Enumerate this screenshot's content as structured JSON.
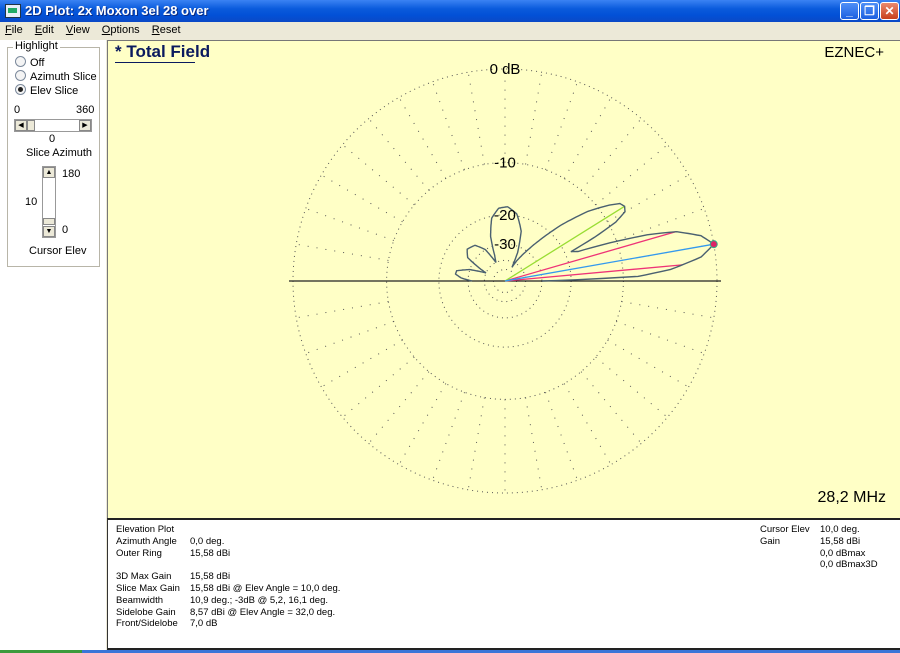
{
  "window": {
    "title": "2D Plot: 2x Moxon 3el 28 over",
    "controls": {
      "minimize": "_",
      "restore": "❐",
      "close": "✕"
    }
  },
  "menu": {
    "items": [
      {
        "label": "File",
        "accel": "F"
      },
      {
        "label": "Edit",
        "accel": "E"
      },
      {
        "label": "View",
        "accel": "V"
      },
      {
        "label": "Options",
        "accel": "O"
      },
      {
        "label": "Reset",
        "accel": "R"
      }
    ]
  },
  "sidebar": {
    "group_label": "Highlight",
    "radios": [
      {
        "label": "Off",
        "checked": false
      },
      {
        "label": "Azimuth Slice",
        "checked": false
      },
      {
        "label": "Elev Slice",
        "checked": true
      }
    ],
    "slice_azimuth": {
      "min": "0",
      "max": "360",
      "value": "0",
      "label": "Slice Azimuth"
    },
    "cursor_elev": {
      "max": "180",
      "min": "0",
      "value": "10",
      "label": "Cursor Elev"
    }
  },
  "plot": {
    "title": "* Total Field",
    "brand": "EZNEC+",
    "frequency": "28,2 MHz",
    "colors": {
      "background": "#ffffc6",
      "pattern": "#4a6070",
      "cursor": "#3399ee",
      "beamwidth": "#ee3377",
      "sidelobe": "#99dd33",
      "marker": "#dd2266"
    }
  },
  "chart_data": {
    "type": "polar",
    "title": "* Total Field",
    "scale": "ARRL log",
    "ring_labels": [
      "0 dB",
      "-10",
      "-20",
      "-30"
    ],
    "rings_db": [
      0,
      -10,
      -20,
      -30,
      -40,
      -50
    ],
    "radials_deg_step": 10,
    "pattern": [
      [
        0,
        -30
      ],
      [
        2,
        -8
      ],
      [
        4,
        -4.2
      ],
      [
        5.2,
        -3
      ],
      [
        7,
        -1.2
      ],
      [
        10,
        0
      ],
      [
        13,
        -0.9
      ],
      [
        16.1,
        -3
      ],
      [
        18,
        -6
      ],
      [
        20,
        -11
      ],
      [
        22,
        -17
      ],
      [
        24,
        -18.5
      ],
      [
        26,
        -13
      ],
      [
        28,
        -9
      ],
      [
        30,
        -7.3
      ],
      [
        32,
        -7.0
      ],
      [
        34,
        -7.3
      ],
      [
        36,
        -8.5
      ],
      [
        40,
        -11.5
      ],
      [
        45,
        -17
      ],
      [
        50,
        -24
      ],
      [
        55,
        -31
      ],
      [
        60,
        -38
      ],
      [
        63,
        -45
      ],
      [
        66,
        -33
      ],
      [
        72,
        -24
      ],
      [
        80,
        -19.5
      ],
      [
        88,
        -18
      ],
      [
        95,
        -18.3
      ],
      [
        102,
        -20.5
      ],
      [
        108,
        -26
      ],
      [
        112,
        -35
      ],
      [
        116,
        -40
      ],
      [
        122,
        -30
      ],
      [
        130,
        -26
      ],
      [
        140,
        -25
      ],
      [
        148,
        -27
      ],
      [
        153,
        -34
      ],
      [
        157,
        -40
      ],
      [
        162,
        -30
      ],
      [
        168,
        -25
      ],
      [
        172,
        -24.8
      ],
      [
        176,
        -27
      ],
      [
        180,
        -32
      ]
    ],
    "cursor": {
      "elev_deg": 10.0,
      "gain_dbi": 15.58
    },
    "beamwidth_lines_deg": [
      5.2,
      16.1
    ],
    "sidelobe_deg": 32.0
  },
  "info": {
    "left": [
      {
        "k": "Elevation Plot",
        "v": ""
      },
      {
        "k": "Azimuth Angle",
        "v": "0,0 deg."
      },
      {
        "k": "Outer Ring",
        "v": "15,58 dBi"
      },
      {
        "k": "",
        "v": ""
      },
      {
        "k": "3D Max Gain",
        "v": "15,58 dBi"
      },
      {
        "k": "Slice Max Gain",
        "v": "15,58 dBi @ Elev Angle = 10,0 deg."
      },
      {
        "k": "Beamwidth",
        "v": "10,9 deg.; -3dB @ 5,2, 16,1 deg."
      },
      {
        "k": "Sidelobe Gain",
        "v": "8,57 dBi @ Elev Angle = 32,0 deg."
      },
      {
        "k": "Front/Sidelobe",
        "v": "7,0 dB"
      }
    ],
    "right": [
      {
        "k": "Cursor Elev",
        "v": "10,0 deg."
      },
      {
        "k": "Gain",
        "v": "15,58 dBi"
      },
      {
        "k": "",
        "v": "0,0 dBmax"
      },
      {
        "k": "",
        "v": "0,0 dBmax3D"
      }
    ]
  }
}
